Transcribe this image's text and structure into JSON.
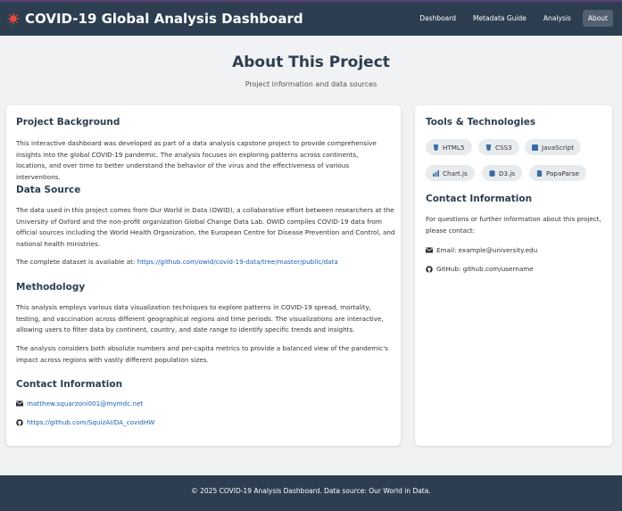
{
  "app": {
    "title": "COVID-19 Global Analysis Dashboard",
    "nav": [
      {
        "label": "Dashboard"
      },
      {
        "label": "Metadata Guide"
      },
      {
        "label": "Analysis"
      },
      {
        "label": "About",
        "active": true
      }
    ]
  },
  "hero": {
    "title": "About This Project",
    "subtitle": "Project information and data sources"
  },
  "main": {
    "background_heading": "Project Background",
    "background_text": "This interactive dashboard was developed as part of a data analysis capstone project to provide comprehensive insights into the global COVID-19 pandemic. The analysis focuses on exploring patterns across continents, locations, and over time to better understand the behavior of the virus and the effectiveness of various interventions.",
    "source_heading": "Data Source",
    "source_text": "The data used in this project comes from Our World in Data (OWID), a collaborative effort between researchers at the University of Oxford and the non-profit organization Global Change Data Lab. OWID compiles COVID-19 data from official sources including the World Health Organization, the European Centre for Disease Prevention and Control, and national health ministries.",
    "source_available_prefix": "The complete dataset is available at: ",
    "source_link": "https://github.com/owid/covid-19-data/tree/master/public/data",
    "method_heading": "Methodology",
    "method_text1": "This analysis employs various data visualization techniques to explore patterns in COVID-19 spread, mortality, testing, and vaccination across different geographical regions and time periods. The visualizations are interactive, allowing users to filter data by continent, country, and date range to identify specific trends and insights.",
    "method_text2": "The analysis considers both absolute numbers and per-capita metrics to provide a balanced view of the pandemic's impact across regions with vastly different population sizes.",
    "contact_heading": "Contact Information",
    "contact_email": "matthew.squarzoni001@mymdc.net",
    "contact_github": "https://github.com/SquizAI/DA_covidHW"
  },
  "side": {
    "tools_heading": "Tools & Technologies",
    "tools": [
      "HTML5",
      "CSS3",
      "JavaScript",
      "Chart.js",
      "D3.js",
      "PapaParse"
    ],
    "contact_heading": "Contact Information",
    "contact_text": "For questions or further information about this project, please contact:",
    "email_line": "Email: example@university.edu",
    "github_line": "GitHub: github.com/username"
  },
  "footer": {
    "text": "© 2025 COVID-19 Analysis Dashboard. Data source: Our World in Data."
  },
  "colors": {
    "header": "#2c3e50",
    "accent_icon": "#e74c3c",
    "link": "#1a5fb4",
    "chip": "#e8ebee"
  },
  "icons": {
    "brand": "virus-icon",
    "html5": "html5-icon",
    "css3": "css3-icon",
    "javascript": "js-icon",
    "chartjs": "chart-icon",
    "d3": "database-icon",
    "papaparse": "file-icon",
    "email": "envelope-icon",
    "github": "github-icon"
  }
}
